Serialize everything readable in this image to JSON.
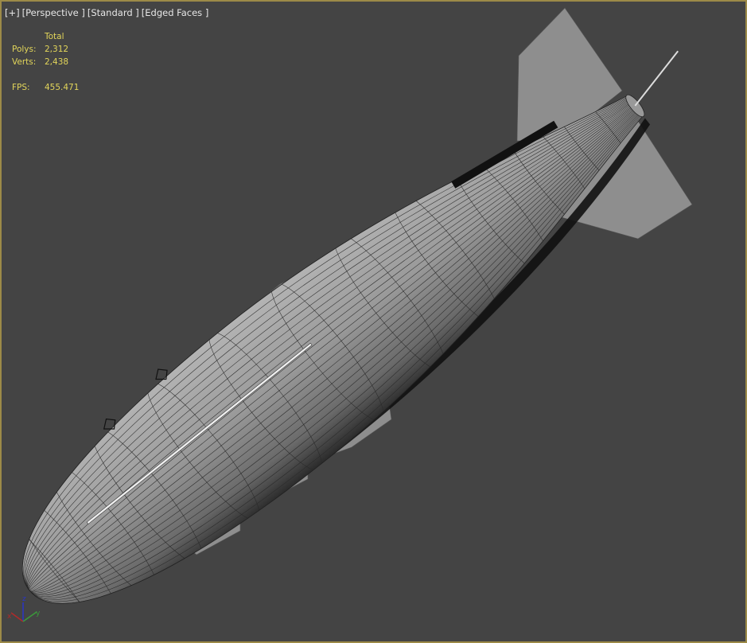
{
  "viewport": {
    "menu_plus": "[+]",
    "view_label": "[Perspective ]",
    "shading_label": "[Standard ]",
    "edges_label": "[Edged Faces ]"
  },
  "stats": {
    "header": "Total",
    "polys_label": "Polys:",
    "polys_value": "2,312",
    "verts_label": "Verts:",
    "verts_value": "2,438",
    "fps_label": "FPS:",
    "fps_value": "455.471"
  },
  "colors": {
    "border": "#9c8a48",
    "background": "#444444",
    "stats_text": "#e2d55a"
  },
  "gizmo": {
    "x": "x",
    "y": "y",
    "z": "z"
  }
}
